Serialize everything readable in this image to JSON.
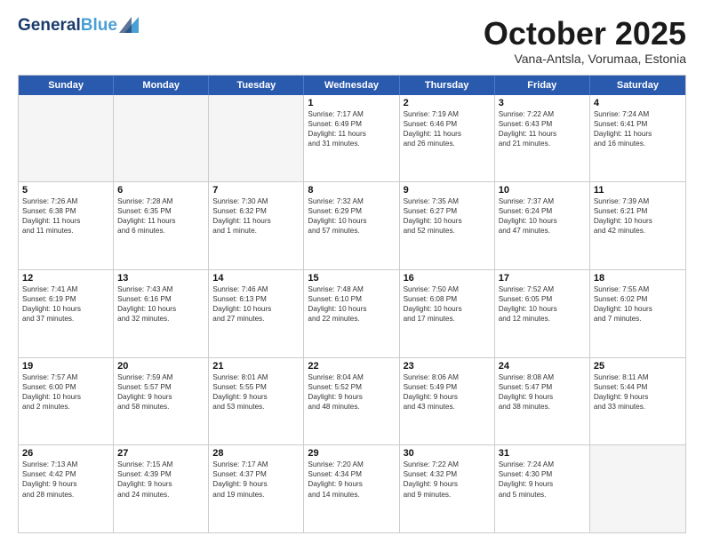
{
  "header": {
    "logo_general": "General",
    "logo_blue": "Blue",
    "month": "October 2025",
    "location": "Vana-Antsla, Vorumaa, Estonia"
  },
  "days_of_week": [
    "Sunday",
    "Monday",
    "Tuesday",
    "Wednesday",
    "Thursday",
    "Friday",
    "Saturday"
  ],
  "rows": [
    [
      {
        "day": "",
        "empty": true
      },
      {
        "day": "",
        "empty": true
      },
      {
        "day": "",
        "empty": true
      },
      {
        "day": "1",
        "lines": [
          "Sunrise: 7:17 AM",
          "Sunset: 6:49 PM",
          "Daylight: 11 hours",
          "and 31 minutes."
        ]
      },
      {
        "day": "2",
        "lines": [
          "Sunrise: 7:19 AM",
          "Sunset: 6:46 PM",
          "Daylight: 11 hours",
          "and 26 minutes."
        ]
      },
      {
        "day": "3",
        "lines": [
          "Sunrise: 7:22 AM",
          "Sunset: 6:43 PM",
          "Daylight: 11 hours",
          "and 21 minutes."
        ]
      },
      {
        "day": "4",
        "lines": [
          "Sunrise: 7:24 AM",
          "Sunset: 6:41 PM",
          "Daylight: 11 hours",
          "and 16 minutes."
        ]
      }
    ],
    [
      {
        "day": "5",
        "lines": [
          "Sunrise: 7:26 AM",
          "Sunset: 6:38 PM",
          "Daylight: 11 hours",
          "and 11 minutes."
        ]
      },
      {
        "day": "6",
        "lines": [
          "Sunrise: 7:28 AM",
          "Sunset: 6:35 PM",
          "Daylight: 11 hours",
          "and 6 minutes."
        ]
      },
      {
        "day": "7",
        "lines": [
          "Sunrise: 7:30 AM",
          "Sunset: 6:32 PM",
          "Daylight: 11 hours",
          "and 1 minute."
        ]
      },
      {
        "day": "8",
        "lines": [
          "Sunrise: 7:32 AM",
          "Sunset: 6:29 PM",
          "Daylight: 10 hours",
          "and 57 minutes."
        ]
      },
      {
        "day": "9",
        "lines": [
          "Sunrise: 7:35 AM",
          "Sunset: 6:27 PM",
          "Daylight: 10 hours",
          "and 52 minutes."
        ]
      },
      {
        "day": "10",
        "lines": [
          "Sunrise: 7:37 AM",
          "Sunset: 6:24 PM",
          "Daylight: 10 hours",
          "and 47 minutes."
        ]
      },
      {
        "day": "11",
        "lines": [
          "Sunrise: 7:39 AM",
          "Sunset: 6:21 PM",
          "Daylight: 10 hours",
          "and 42 minutes."
        ]
      }
    ],
    [
      {
        "day": "12",
        "lines": [
          "Sunrise: 7:41 AM",
          "Sunset: 6:19 PM",
          "Daylight: 10 hours",
          "and 37 minutes."
        ]
      },
      {
        "day": "13",
        "lines": [
          "Sunrise: 7:43 AM",
          "Sunset: 6:16 PM",
          "Daylight: 10 hours",
          "and 32 minutes."
        ]
      },
      {
        "day": "14",
        "lines": [
          "Sunrise: 7:46 AM",
          "Sunset: 6:13 PM",
          "Daylight: 10 hours",
          "and 27 minutes."
        ]
      },
      {
        "day": "15",
        "lines": [
          "Sunrise: 7:48 AM",
          "Sunset: 6:10 PM",
          "Daylight: 10 hours",
          "and 22 minutes."
        ]
      },
      {
        "day": "16",
        "lines": [
          "Sunrise: 7:50 AM",
          "Sunset: 6:08 PM",
          "Daylight: 10 hours",
          "and 17 minutes."
        ]
      },
      {
        "day": "17",
        "lines": [
          "Sunrise: 7:52 AM",
          "Sunset: 6:05 PM",
          "Daylight: 10 hours",
          "and 12 minutes."
        ]
      },
      {
        "day": "18",
        "lines": [
          "Sunrise: 7:55 AM",
          "Sunset: 6:02 PM",
          "Daylight: 10 hours",
          "and 7 minutes."
        ]
      }
    ],
    [
      {
        "day": "19",
        "lines": [
          "Sunrise: 7:57 AM",
          "Sunset: 6:00 PM",
          "Daylight: 10 hours",
          "and 2 minutes."
        ]
      },
      {
        "day": "20",
        "lines": [
          "Sunrise: 7:59 AM",
          "Sunset: 5:57 PM",
          "Daylight: 9 hours",
          "and 58 minutes."
        ]
      },
      {
        "day": "21",
        "lines": [
          "Sunrise: 8:01 AM",
          "Sunset: 5:55 PM",
          "Daylight: 9 hours",
          "and 53 minutes."
        ]
      },
      {
        "day": "22",
        "lines": [
          "Sunrise: 8:04 AM",
          "Sunset: 5:52 PM",
          "Daylight: 9 hours",
          "and 48 minutes."
        ]
      },
      {
        "day": "23",
        "lines": [
          "Sunrise: 8:06 AM",
          "Sunset: 5:49 PM",
          "Daylight: 9 hours",
          "and 43 minutes."
        ]
      },
      {
        "day": "24",
        "lines": [
          "Sunrise: 8:08 AM",
          "Sunset: 5:47 PM",
          "Daylight: 9 hours",
          "and 38 minutes."
        ]
      },
      {
        "day": "25",
        "lines": [
          "Sunrise: 8:11 AM",
          "Sunset: 5:44 PM",
          "Daylight: 9 hours",
          "and 33 minutes."
        ]
      }
    ],
    [
      {
        "day": "26",
        "lines": [
          "Sunrise: 7:13 AM",
          "Sunset: 4:42 PM",
          "Daylight: 9 hours",
          "and 28 minutes."
        ]
      },
      {
        "day": "27",
        "lines": [
          "Sunrise: 7:15 AM",
          "Sunset: 4:39 PM",
          "Daylight: 9 hours",
          "and 24 minutes."
        ]
      },
      {
        "day": "28",
        "lines": [
          "Sunrise: 7:17 AM",
          "Sunset: 4:37 PM",
          "Daylight: 9 hours",
          "and 19 minutes."
        ]
      },
      {
        "day": "29",
        "lines": [
          "Sunrise: 7:20 AM",
          "Sunset: 4:34 PM",
          "Daylight: 9 hours",
          "and 14 minutes."
        ]
      },
      {
        "day": "30",
        "lines": [
          "Sunrise: 7:22 AM",
          "Sunset: 4:32 PM",
          "Daylight: 9 hours",
          "and 9 minutes."
        ]
      },
      {
        "day": "31",
        "lines": [
          "Sunrise: 7:24 AM",
          "Sunset: 4:30 PM",
          "Daylight: 9 hours",
          "and 5 minutes."
        ]
      },
      {
        "day": "",
        "empty": true
      }
    ]
  ]
}
